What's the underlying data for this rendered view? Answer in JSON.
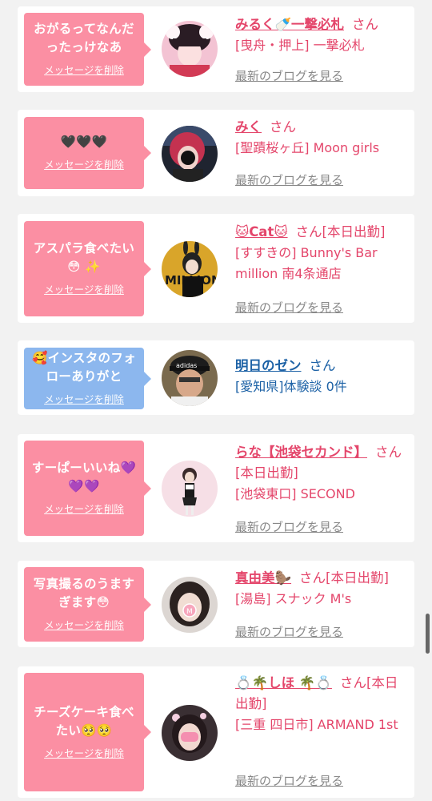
{
  "delete_label": "メッセージを削除",
  "san_label": "さん",
  "blog_label": "最新のブログを見る",
  "colors": {
    "pink_bubble": "#fb8fa3",
    "blue_bubble": "#8cb7ee",
    "name_pink": "#e4466b",
    "name_blue": "#1d62a6"
  },
  "messages": [
    {
      "message": "おがるってなんだったっけなあ",
      "name": "みるく🍼一撃必札",
      "shop": "[曳舟・押上] 一撃必札",
      "has_blog": true
    },
    {
      "message": "🖤🖤🖤",
      "name": "みく",
      "shop": "[聖蹟桜ヶ丘] Moon girls",
      "has_blog": true
    },
    {
      "message": "アスパラ食べたい😳 ✨",
      "name": "🐱Cat🐱",
      "status": "[本日出勤]",
      "shop": "[すすきの] Bunny's Bar million 南4条通店",
      "has_blog": true
    },
    {
      "message": "🥰インスタのフォローありがと",
      "name": "明日のゼン",
      "shop": "[愛知県]体験談 0件",
      "has_blog": false
    },
    {
      "message": "すーぱーいいね💜💜💜",
      "name": "らな【池袋セカンド】",
      "status": "[本日出勤]",
      "shop": "[池袋東口] SECOND",
      "has_blog": true
    },
    {
      "message": "写真撮るのうますぎます😳",
      "name": "真由美🦫",
      "status": "[本日出勤]",
      "shop": "[湯島] スナック M's",
      "has_blog": true
    },
    {
      "message": "チーズケーキ食べたい🥺🥺",
      "name": "💍🌴しほ 🌴💍",
      "status": "[本日出勤]",
      "shop": "[三重 四日市] ARMAND 1st",
      "has_blog": true
    }
  ]
}
